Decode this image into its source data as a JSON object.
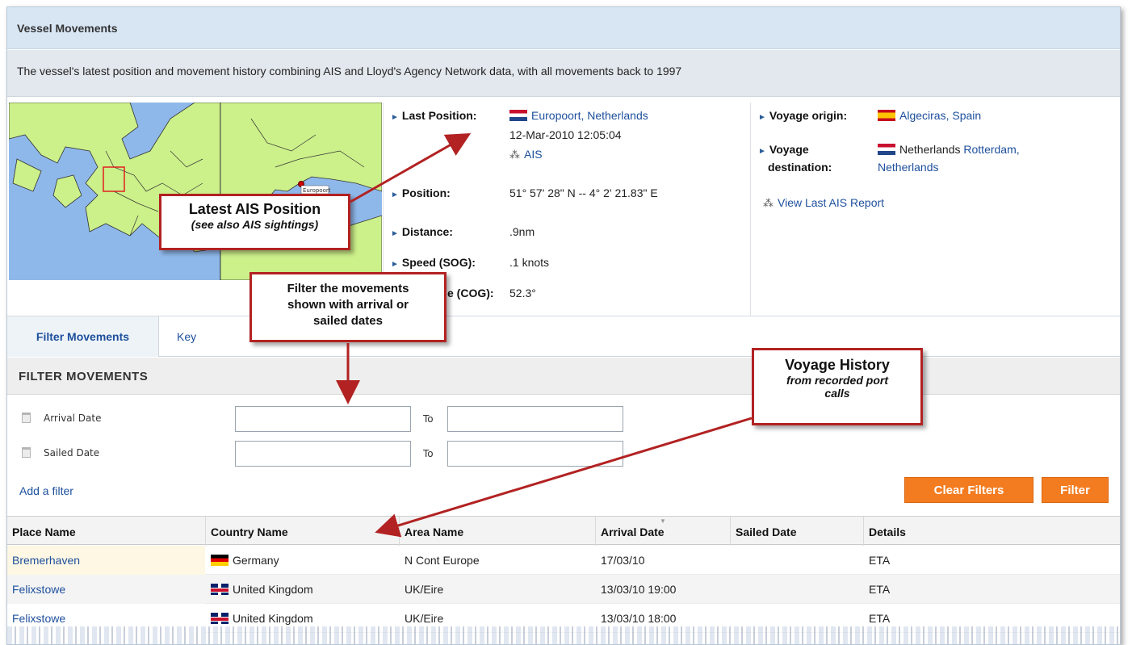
{
  "panel": {
    "title": "Vessel Movements",
    "description": "The vessel's latest position and movement history combining AIS and Lloyd's Agency Network data, with all movements back to 1997"
  },
  "map": {
    "marker_label": "Europoort"
  },
  "position": {
    "last_position_label": "Last Position:",
    "last_position_value": "Europoort, Netherlands",
    "timestamp": "12-Mar-2010 12:05:04",
    "ais_link": "AIS",
    "position_label": "Position:",
    "position_value": "51° 57' 28\" N -- 4° 2' 21.83\" E",
    "distance_label": "Distance:",
    "distance_value": ".9nm",
    "speed_label": "Speed (SOG):",
    "speed_value": ".1 knots",
    "course_label_partial": "e (COG):",
    "course_value": "52.3°"
  },
  "voyage": {
    "origin_label": "Voyage origin:",
    "origin_value": "Algeciras, Spain",
    "dest_label_1": "Voyage",
    "dest_label_2": "destination:",
    "dest_prefix": "Netherlands",
    "dest_value_1": "Rotterdam,",
    "dest_value_2": "Netherlands",
    "view_report": "View Last AIS Report"
  },
  "tabs": {
    "filter_movements": "Filter Movements",
    "key": "Key"
  },
  "filters": {
    "heading": "FILTER MOVEMENTS",
    "arrival_label": "Arrival Date",
    "sailed_label": "Sailed Date",
    "to_label": "To",
    "arrival_from": "",
    "arrival_to": "",
    "sailed_from": "",
    "sailed_to": "",
    "add_filter": "Add a filter",
    "clear_button": "Clear Filters",
    "filter_button": "Filter"
  },
  "table": {
    "headers": [
      "Place Name",
      "Country Name",
      "Area Name",
      "Arrival Date",
      "Sailed Date",
      "Details"
    ],
    "rows": [
      {
        "place": "Bremerhaven",
        "country": "Germany",
        "flag": "de",
        "area": "N Cont Europe",
        "arrival": "17/03/10",
        "sailed": "",
        "details": "ETA"
      },
      {
        "place": "Felixstowe",
        "country": "United Kingdom",
        "flag": "uk",
        "area": "UK/Eire",
        "arrival": "13/03/10 19:00",
        "sailed": "",
        "details": "ETA"
      },
      {
        "place": "Felixstowe",
        "country": "United Kingdom",
        "flag": "uk",
        "area": "UK/Eire",
        "arrival": "13/03/10 18:00",
        "sailed": "",
        "details": "ETA"
      }
    ]
  },
  "callouts": {
    "ais_title": "Latest AIS Position",
    "ais_sub": "(see also AIS sightings)",
    "filter_text_1": "Filter the movements",
    "filter_text_2": "shown with arrival or",
    "filter_text_3": "sailed dates",
    "history_title": "Voyage History",
    "history_sub_1": "from recorded port",
    "history_sub_2": "calls"
  },
  "colors": {
    "accent_orange": "#f47c20",
    "callout_red": "#b22222",
    "link_blue": "#1d4f9c",
    "header_blue": "#d8e6f4"
  }
}
